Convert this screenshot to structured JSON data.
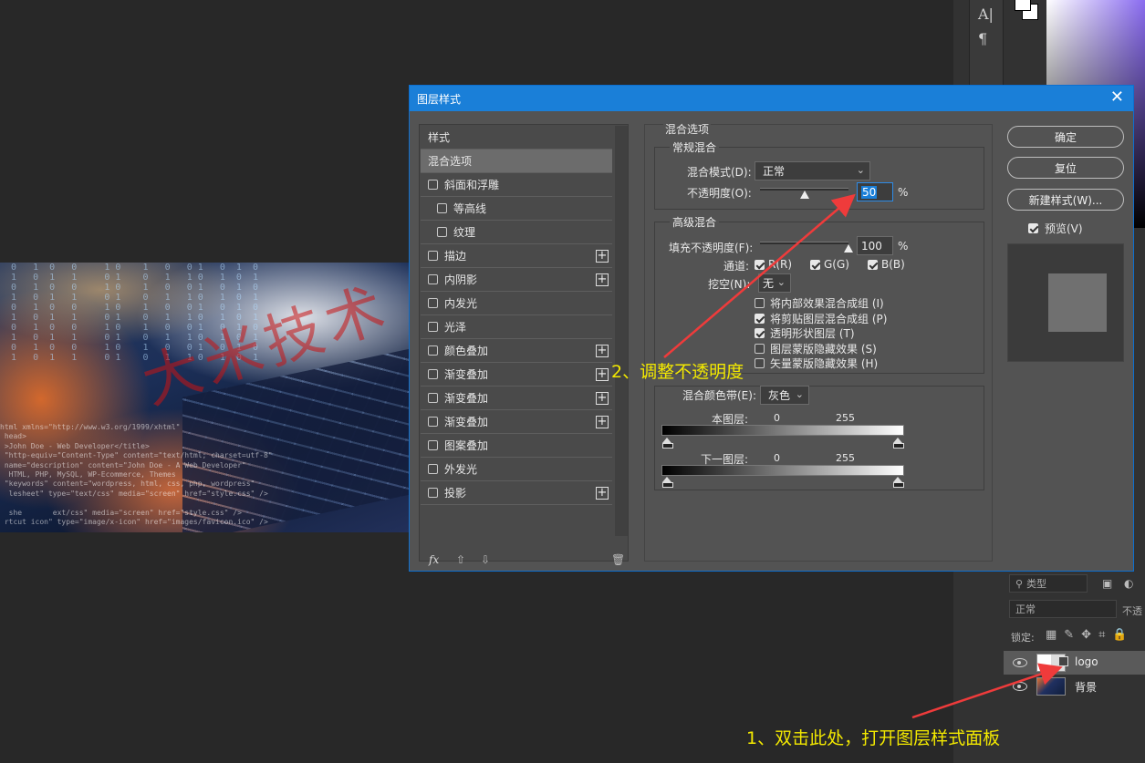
{
  "dialog": {
    "title": "图层样式",
    "close_icon": "close-icon"
  },
  "styles_list": {
    "header": "样式",
    "items": [
      {
        "label": "混合选项",
        "checkbox": false,
        "selected": true,
        "plus": false,
        "indent": false
      },
      {
        "label": "斜面和浮雕",
        "checkbox": true,
        "checked": false,
        "plus": false,
        "indent": false
      },
      {
        "label": "等高线",
        "checkbox": true,
        "checked": false,
        "plus": false,
        "indent": true
      },
      {
        "label": "纹理",
        "checkbox": true,
        "checked": false,
        "plus": false,
        "indent": true
      },
      {
        "label": "描边",
        "checkbox": true,
        "checked": false,
        "plus": true,
        "indent": false
      },
      {
        "label": "内阴影",
        "checkbox": true,
        "checked": false,
        "plus": true,
        "indent": false
      },
      {
        "label": "内发光",
        "checkbox": true,
        "checked": false,
        "plus": false,
        "indent": false
      },
      {
        "label": "光泽",
        "checkbox": true,
        "checked": false,
        "plus": false,
        "indent": false
      },
      {
        "label": "颜色叠加",
        "checkbox": true,
        "checked": false,
        "plus": true,
        "indent": false
      },
      {
        "label": "渐变叠加",
        "checkbox": true,
        "checked": false,
        "plus": true,
        "indent": false
      },
      {
        "label": "渐变叠加",
        "checkbox": true,
        "checked": false,
        "plus": true,
        "indent": false
      },
      {
        "label": "渐变叠加",
        "checkbox": true,
        "checked": false,
        "plus": true,
        "indent": false
      },
      {
        "label": "图案叠加",
        "checkbox": true,
        "checked": false,
        "plus": false,
        "indent": false
      },
      {
        "label": "外发光",
        "checkbox": true,
        "checked": false,
        "plus": false,
        "indent": false
      },
      {
        "label": "投影",
        "checkbox": true,
        "checked": false,
        "plus": true,
        "indent": false
      }
    ],
    "fx_label": "fx"
  },
  "blend": {
    "section_title": "混合选项",
    "general_title": "常规混合",
    "mode_label": "混合模式(D):",
    "mode_value": "正常",
    "opacity_label": "不透明度(O):",
    "opacity_value": "50",
    "opacity_fraction": 0.5,
    "percent": "%",
    "advanced_title": "高级混合",
    "fill_label": "填充不透明度(F):",
    "fill_value": "100",
    "fill_fraction": 1.0,
    "channels_label": "通道:",
    "channel_r": "R(R)",
    "channel_g": "G(G)",
    "channel_b": "B(B)",
    "knockout_label": "挖空(N):",
    "knockout_value": "无",
    "options": [
      {
        "label": "将内部效果混合成组 (I)",
        "checked": false
      },
      {
        "label": "将剪贴图层混合成组 (P)",
        "checked": true
      },
      {
        "label": "透明形状图层 (T)",
        "checked": true
      },
      {
        "label": "图层蒙版隐藏效果 (S)",
        "checked": false
      },
      {
        "label": "矢量蒙版隐藏效果 (H)",
        "checked": false
      }
    ],
    "blendif_label": "混合颜色带(E):",
    "blendif_value": "灰色",
    "this_layer_label": "本图层:",
    "underlying_label": "下一图层:",
    "range_low": "0",
    "range_high": "255"
  },
  "buttons": {
    "ok": "确定",
    "reset": "复位",
    "new_style": "新建样式(W)...",
    "preview_label": "预览(V)"
  },
  "layers": {
    "filter_placeholder": "类型",
    "blend_mode": "正常",
    "opacity_short": "不透",
    "lock_label": "锁定:",
    "items": [
      {
        "name": "logo",
        "selected": true
      },
      {
        "name": "背景",
        "selected": false
      }
    ]
  },
  "photo": {
    "watermark": "大米技术",
    "code_lines": "html xmlns=\"http://www.w3.org/1999/xhtml\"\n head>\n >John Doe - Web Developer</title>\n \"http-equiv=\"Content-Type\" content=\"text/html; charset=utf-8\"\n name=\"description\" content=\"John Doe - A Web Developer\"\n  HTML, PHP, MySQL, WP-Ecommerce, Themes\n \"keywords\" content=\"wordpress, html, css, php, wordpress\"\n  lesheet\" type=\"text/css\" media=\"screen\" href=\"style.css\" />\n\n  she       ext/css\" media=\"screen\" href=\"style.css\" />\n rtcut icon\" type=\"image/x-icon\" href=\"images/favicon.ico\" />"
  },
  "annotations": {
    "step1": "1、双击此处，打开图层样式面板",
    "step2": "2、调整不透明度"
  },
  "colors": {
    "dialog_bg": "#535353",
    "titlebar": "#1a7fd8",
    "annotation": "#f3e900",
    "arrow": "#ef3b3b"
  }
}
